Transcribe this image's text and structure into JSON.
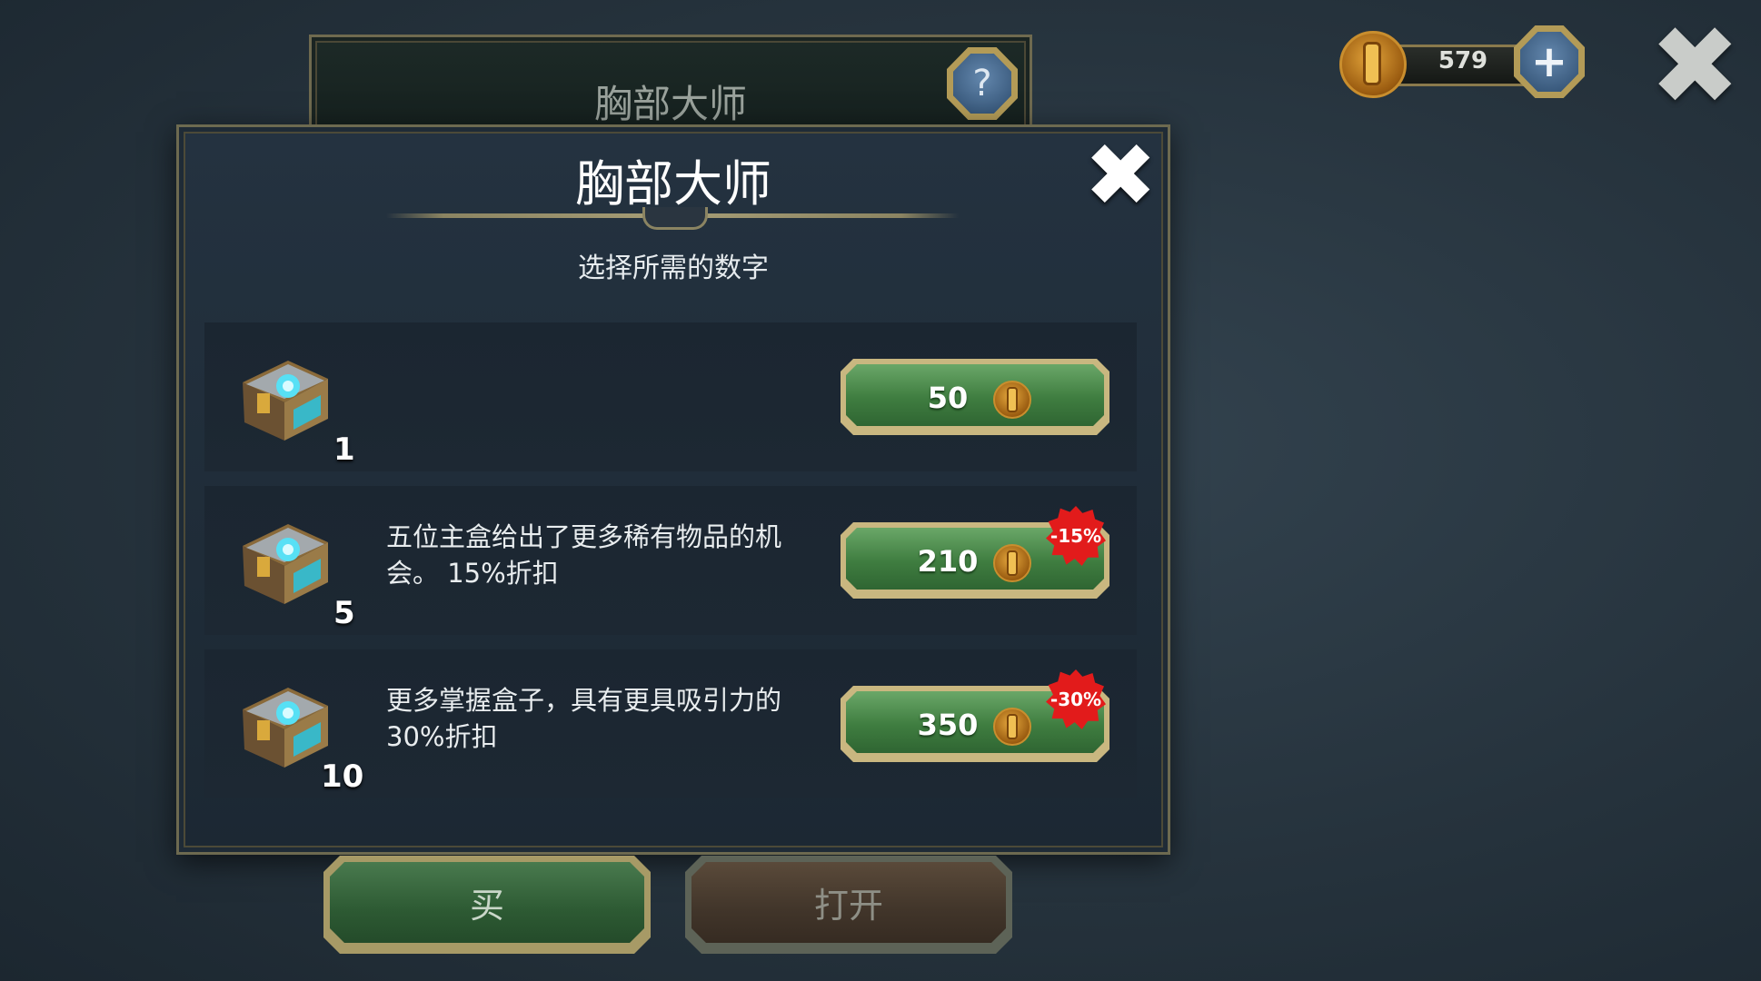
{
  "background_panel": {
    "title": "胸部大师"
  },
  "top_bar": {
    "coins": "579"
  },
  "dialog": {
    "title": "胸部大师",
    "subtitle": "选择所需的数字",
    "options": [
      {
        "quantity": "1",
        "description": "",
        "price": "50",
        "discount": ""
      },
      {
        "quantity": "5",
        "description": "五位主盒给出了更多稀有物品的机会。 15%折扣",
        "price": "210",
        "discount": "-15%"
      },
      {
        "quantity": "10",
        "description": "更多掌握盒子，具有更具吸引力的30%折扣",
        "price": "350",
        "discount": "-30%"
      }
    ]
  },
  "buttons": {
    "buy": "买",
    "open": "打开"
  },
  "icons": {
    "help": "help-icon",
    "add": "plus-icon",
    "close": "close-icon",
    "currency": "gold-coin-icon",
    "chest": "treasure-chest-icon"
  },
  "colors": {
    "price_button": "#3f7d40",
    "discount_badge": "#e21b1b",
    "buy_button": "#2d5a33",
    "open_button": "#41352a"
  }
}
